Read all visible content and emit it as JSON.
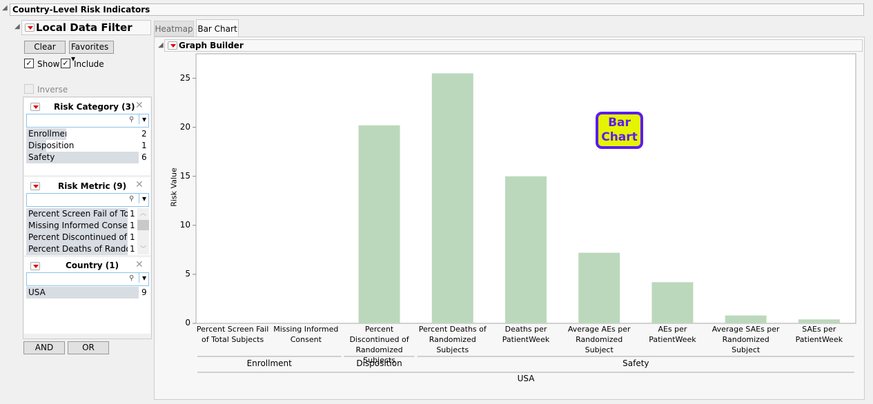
{
  "report": {
    "title": "Country-Level Risk Indicators"
  },
  "filter": {
    "title": "Local Data Filter",
    "clear": "Clear",
    "favorites": "Favorites",
    "show": "Show",
    "include": "Include",
    "inverse": "Inverse",
    "and": "AND",
    "or": "OR",
    "groups": [
      {
        "title": "Risk Category (3)",
        "items": [
          {
            "label": "Enrollment",
            "count": "2"
          },
          {
            "label": "Disposition",
            "count": "1"
          },
          {
            "label": "Safety",
            "count": "6"
          }
        ]
      },
      {
        "title": "Risk Metric (9)",
        "items": [
          {
            "label": "Percent Screen Fail of Tot...",
            "count": "1"
          },
          {
            "label": "Missing Informed Consent",
            "count": "1"
          },
          {
            "label": "Percent Discontinued of R...",
            "count": "1"
          },
          {
            "label": "Percent Deaths of Rando...",
            "count": "1"
          }
        ]
      },
      {
        "title": "Country (1)",
        "items": [
          {
            "label": "USA",
            "count": "9"
          }
        ]
      }
    ]
  },
  "tabs": [
    {
      "label": "Heatmap",
      "active": false
    },
    {
      "label": "Bar Chart",
      "active": true
    }
  ],
  "graph": {
    "title": "Graph Builder",
    "badge": "Bar Chart",
    "badge_colors": {
      "fill": "#e5f500",
      "border": "#5b1cf0",
      "text": "#5b1cf0"
    }
  },
  "chart_data": {
    "type": "bar",
    "ylabel": "Risk Value",
    "ylim": [
      0,
      27.5
    ],
    "yticks": [
      "0",
      "5",
      "10",
      "15",
      "20",
      "25"
    ],
    "bar_color": "#bcd8bc",
    "categories": [
      "Percent Screen Fail of Total Subjects",
      "Missing Informed Consent",
      "Percent Discontinued of Randomized Subjects",
      "Percent Deaths of Randomized Subjects",
      "Deaths per PatientWeek",
      "Average AEs per Randomized Subject",
      "AEs per PatientWeek",
      "Average SAEs per Randomized Subject",
      "SAEs per PatientWeek"
    ],
    "values": [
      0,
      0,
      20.2,
      25.5,
      15.0,
      7.2,
      4.2,
      0.8,
      0.4
    ],
    "groups": [
      {
        "label": "Enrollment",
        "span": 2
      },
      {
        "label": "Disposition",
        "span": 1
      },
      {
        "label": "Safety",
        "span": 6
      }
    ],
    "outer_group": "USA"
  }
}
